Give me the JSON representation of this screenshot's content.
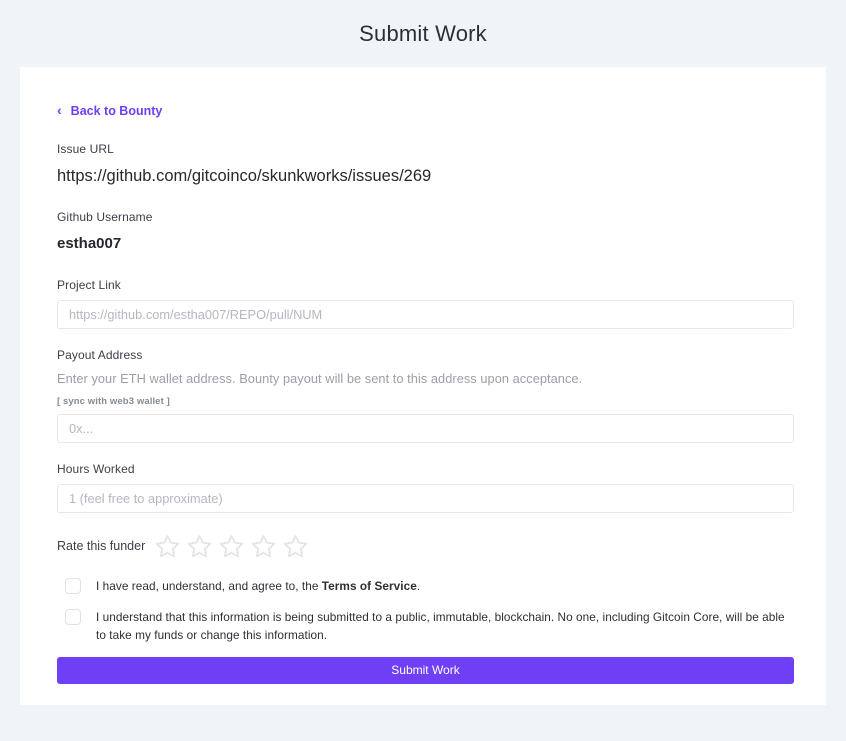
{
  "page": {
    "title": "Submit Work",
    "background_color": "#f1f4f7",
    "accent_color": "#6f3ff5"
  },
  "back_link": {
    "label": "Back to Bounty",
    "chevron": "‹"
  },
  "issue": {
    "label": "Issue URL",
    "value": "https://github.com/gitcoinco/skunkworks/issues/269"
  },
  "github_username": {
    "label": "Github Username",
    "value": "estha007"
  },
  "project_link": {
    "label": "Project Link",
    "placeholder": "https://github.com/estha007/REPO/pull/NUM",
    "value": ""
  },
  "payout_address": {
    "label": "Payout Address",
    "helper": "Enter your ETH wallet address. Bounty payout will be sent to this address upon acceptance.",
    "sync_note": "[ sync with web3 wallet ]",
    "placeholder": "0x...",
    "value": ""
  },
  "hours_worked": {
    "label": "Hours Worked",
    "placeholder": "1 (feel free to approximate)",
    "value": ""
  },
  "rating": {
    "label": "Rate this funder",
    "max": 5,
    "value": 0,
    "star_color": "#e2e4e7"
  },
  "terms_checkbox": {
    "checked": false,
    "text_before": "I have read, understand, and agree to, the ",
    "link_text": "Terms of Service",
    "text_after": "."
  },
  "blockchain_checkbox": {
    "checked": false,
    "text": "I understand that this information is being submitted to a public, immutable, blockchain. No one, including Gitcoin Core, will be able to take my funds or change this information."
  },
  "submit": {
    "label": "Submit Work"
  }
}
